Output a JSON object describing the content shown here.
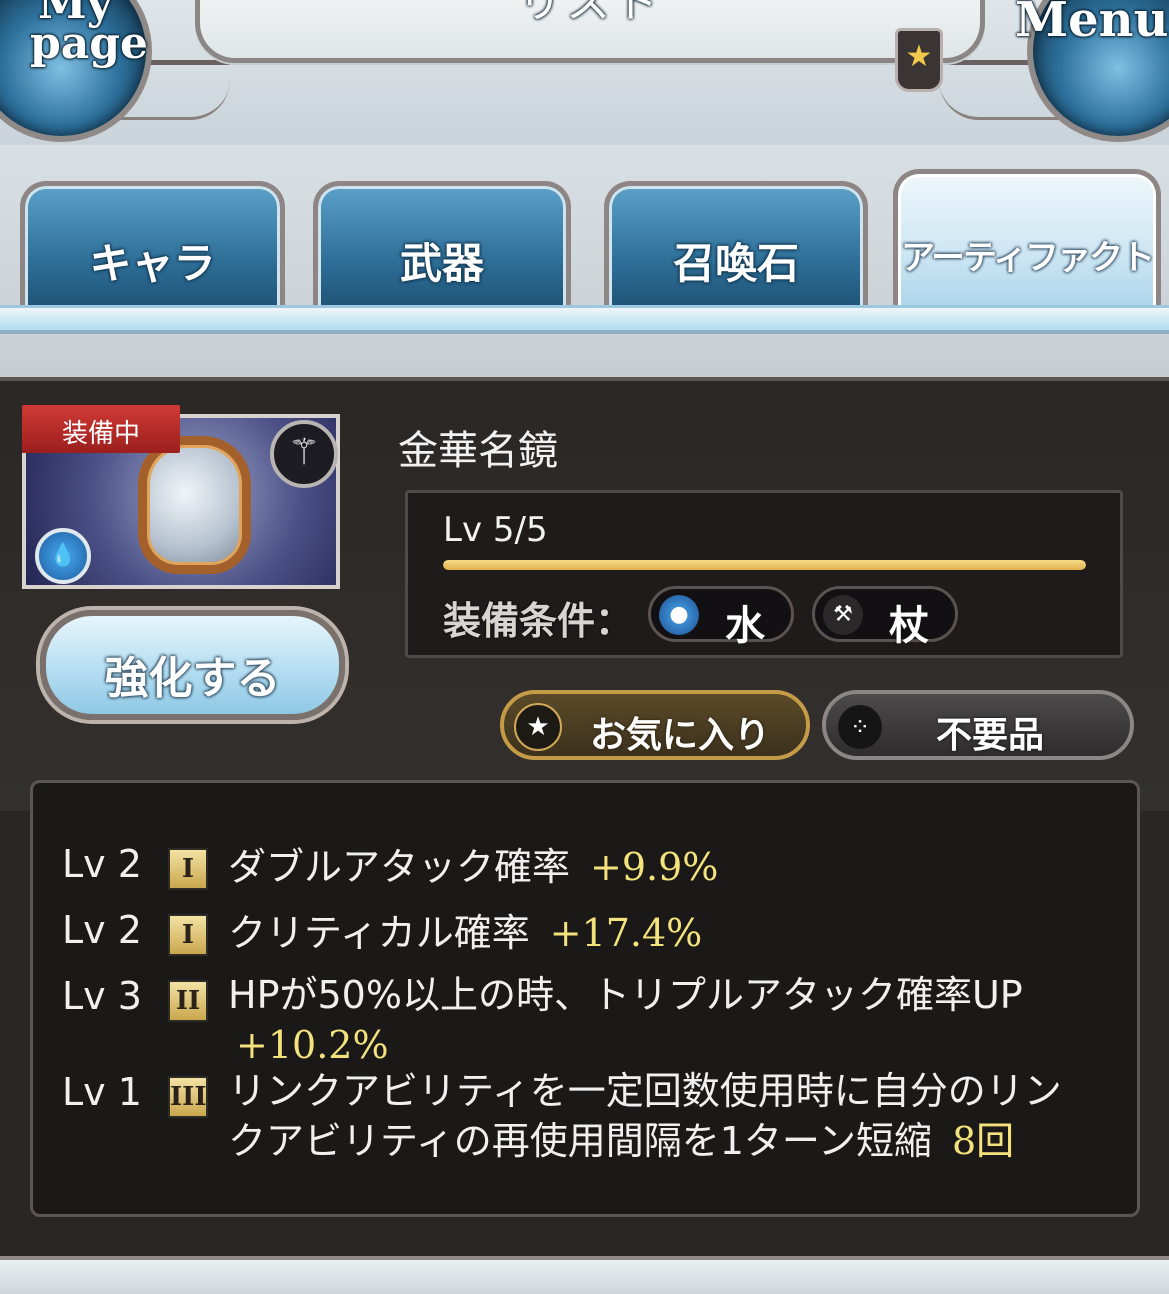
{
  "header": {
    "title": "リスト",
    "mypage_top": "My",
    "mypage_bottom": "page",
    "menu_label": "Menu",
    "fav_icon": "star-icon"
  },
  "tabs": [
    {
      "label": "キャラ",
      "active": false
    },
    {
      "label": "武器",
      "active": false
    },
    {
      "label": "召喚石",
      "active": false
    },
    {
      "label": "アーティファクト",
      "active": true
    }
  ],
  "artifact": {
    "equipped_badge": "装備中",
    "name": "金華名鏡",
    "level_text": "Lv 5/5",
    "level_progress": 1.0,
    "enhance_label": "強化する",
    "condition_label": "装備条件：",
    "conditions": [
      {
        "label": "水",
        "icon": "water-orb-icon"
      },
      {
        "label": "杖",
        "icon": "staff-icon"
      }
    ],
    "favorite_label": "お気に入り",
    "junk_label": "不要品"
  },
  "skills": [
    {
      "lv": "Lv 2",
      "tier": "I",
      "text": "ダブルアタック確率",
      "value": "+9.9%"
    },
    {
      "lv": "Lv 2",
      "tier": "I",
      "text": "クリティカル確率",
      "value": "+17.4%"
    },
    {
      "lv": "Lv 3",
      "tier": "II",
      "text": "HPが50%以上の時、トリプルアタック確率UP",
      "value": "+10.2%"
    },
    {
      "lv": "Lv 1",
      "tier": "III",
      "text": "リンクアビリティを一定回数使用時に自分のリンクアビリティの再使用間隔を1ターン短縮",
      "value": "8回"
    }
  ],
  "colors": {
    "accent_blue": "#2f6f98",
    "value_yellow": "#f4e27c",
    "level_bar": "#e0b14f",
    "equipped_red": "#c0302c"
  }
}
